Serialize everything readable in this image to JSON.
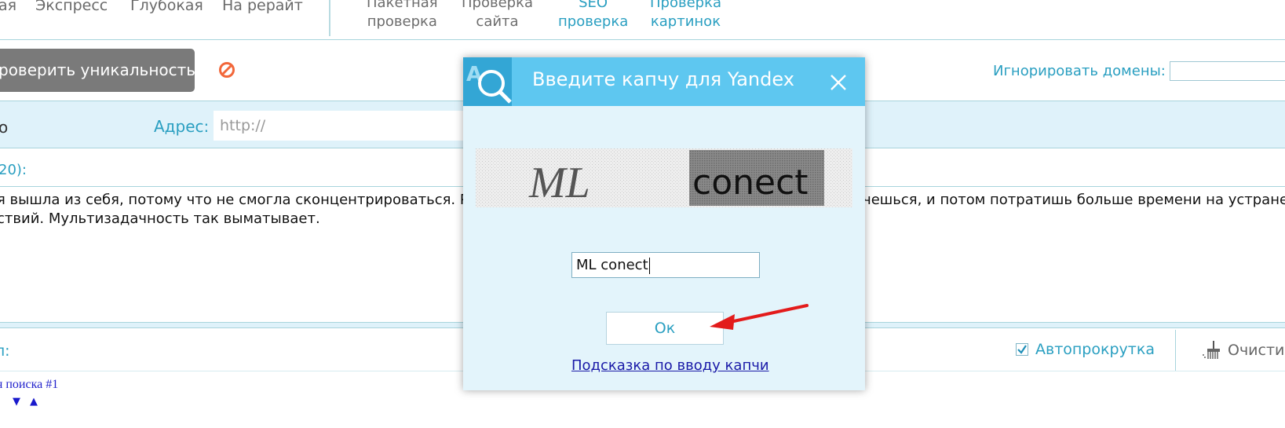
{
  "top_nav": {
    "group1": [
      "ая",
      "Экспресс",
      "Глубокая",
      "На рерайт"
    ],
    "group2": [
      {
        "line1": "Пакетная",
        "line2": "проверка"
      },
      {
        "line1": "Проверка",
        "line2": "сайта"
      },
      {
        "line1": "SEO",
        "line2": "проверка"
      },
      {
        "line1": "Проверка",
        "line2": "картинок"
      }
    ]
  },
  "toolbar": {
    "check_button": "роверить уникальность",
    "ignore_domains_label": "Игнорировать домены:",
    "ignore_domains_value": ""
  },
  "address": {
    "left_fragment": "о",
    "label": "Адрес:",
    "placeholder": "http://"
  },
  "text_section": {
    "count_label": "20):",
    "line1_left": "я вышла из себя, потому что не смогла сконцентрироваться. Ре",
    "line1_right": "ечешься, и потом потратишь больше времени на устранени",
    "line2": "ствий. Мультизадачность так выматывает."
  },
  "results": {
    "label": "л:",
    "autoscroll_label": "Автопрокрутка",
    "autoscroll_checked": true,
    "clear_label": "Очисти",
    "search_link": "я поиска #1",
    "arrow_down": "▼",
    "arrow_up": "▲"
  },
  "dialog": {
    "title": "Введите капчу для Yandex",
    "captcha_word1": "ML",
    "captcha_word2": "conect",
    "input_value": "ML conect",
    "ok_label": "Ок",
    "hint_link": "Подсказка по вводу капчи"
  },
  "colors": {
    "accent": "#2a9fc1",
    "header_blue": "#5ec7f0",
    "band": "#dff2fa",
    "arrow": "#e31b1b"
  }
}
